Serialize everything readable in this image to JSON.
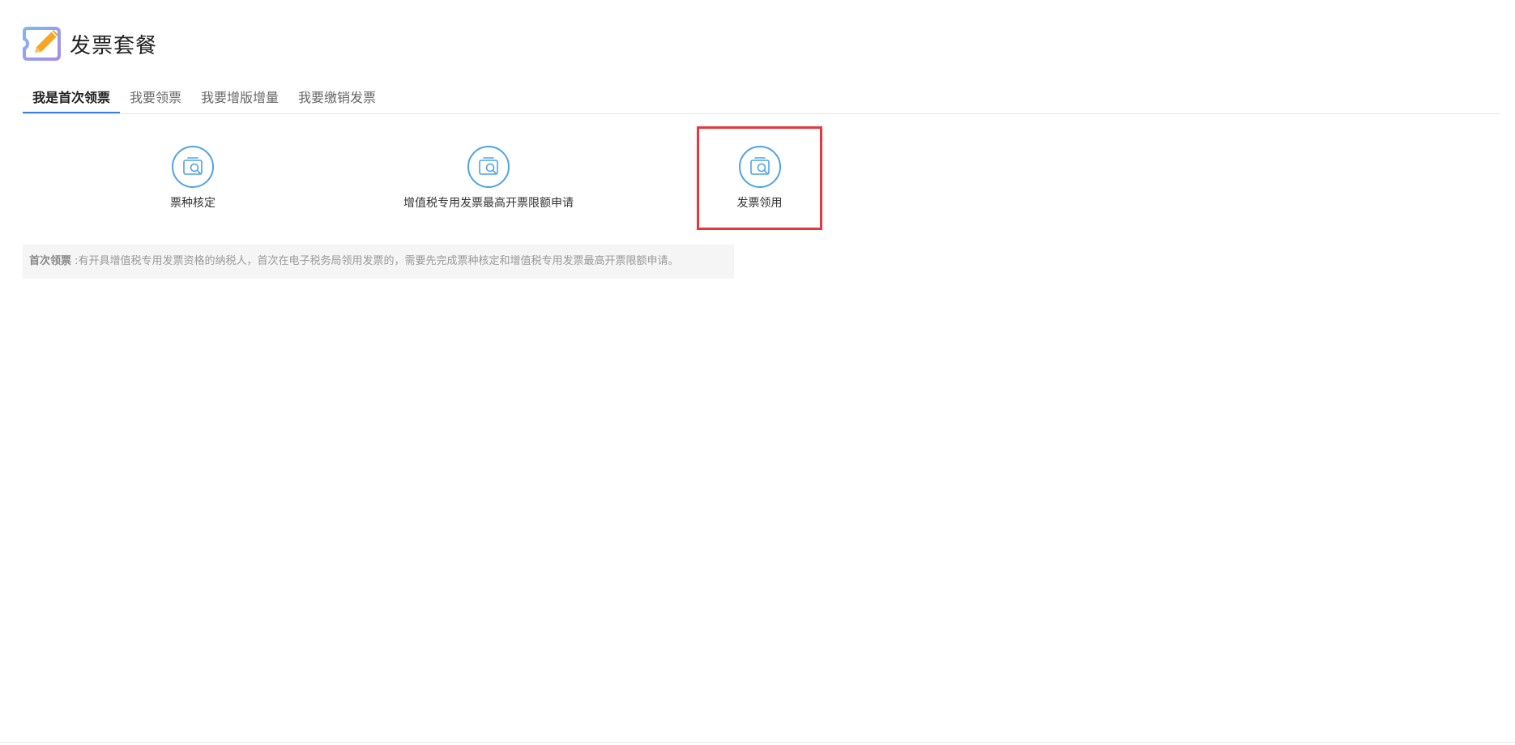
{
  "header": {
    "title": "发票套餐",
    "icon": "invoice-edit-icon"
  },
  "tabs": [
    {
      "label": "我是首次领票",
      "active": true
    },
    {
      "label": "我要领票",
      "active": false
    },
    {
      "label": "我要增版增量",
      "active": false
    },
    {
      "label": "我要缴销发票",
      "active": false
    }
  ],
  "services": [
    {
      "label": "票种核定",
      "icon": "invoice-search-icon",
      "highlighted": false
    },
    {
      "label": "增值税专用发票最高开票限额申请",
      "icon": "invoice-search-icon",
      "highlighted": false
    },
    {
      "label": "发票领用",
      "icon": "invoice-search-icon",
      "highlighted": true
    }
  ],
  "notice": {
    "title": "首次领票",
    "text": ":有开具增值税专用发票资格的纳税人，首次在电子税务局领用发票的，需要先完成票种核定和增值税专用发票最高开票限额申请。"
  },
  "colors": {
    "accent": "#3d7fe6",
    "icon_blue": "#4fa3e8",
    "highlight_red": "#e8363c",
    "logo_orange": "#f5a623"
  }
}
